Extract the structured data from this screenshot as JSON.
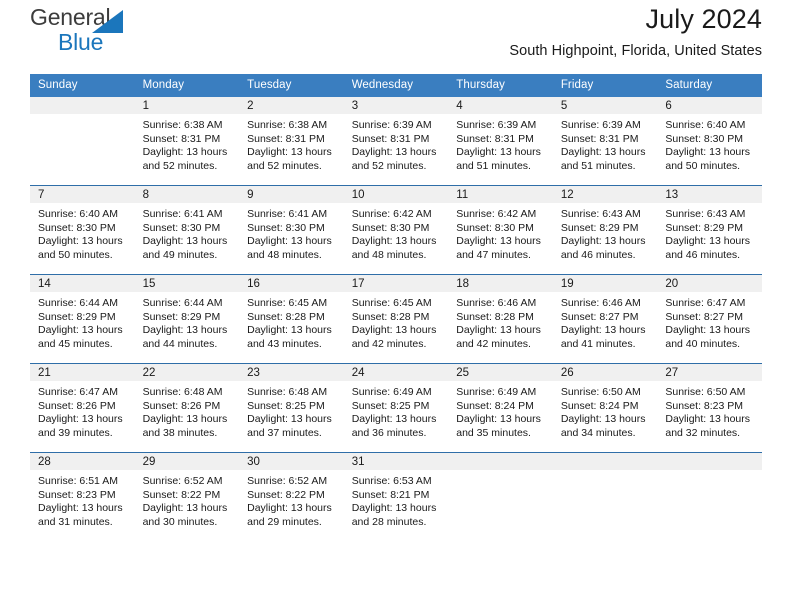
{
  "brand": {
    "word1": "General",
    "word2": "Blue",
    "triangle_color": "#1b76bc",
    "text_color": "#3c3c3c"
  },
  "header": {
    "title": "July 2024",
    "location": "South Highpoint, Florida, United States"
  },
  "theme": {
    "header_bg": "#3a7ec0",
    "row_divider": "#2f6ea8",
    "daynum_bg": "#f0f0f0",
    "text": "#1a1a1a"
  },
  "weekdays": [
    "Sunday",
    "Monday",
    "Tuesday",
    "Wednesday",
    "Thursday",
    "Friday",
    "Saturday"
  ],
  "weeks": [
    {
      "days": [
        {
          "num": "",
          "sunrise": "",
          "sunset": "",
          "daylight1": "",
          "daylight2": "",
          "empty": true
        },
        {
          "num": "1",
          "sunrise": "Sunrise: 6:38 AM",
          "sunset": "Sunset: 8:31 PM",
          "daylight1": "Daylight: 13 hours",
          "daylight2": "and 52 minutes."
        },
        {
          "num": "2",
          "sunrise": "Sunrise: 6:38 AM",
          "sunset": "Sunset: 8:31 PM",
          "daylight1": "Daylight: 13 hours",
          "daylight2": "and 52 minutes."
        },
        {
          "num": "3",
          "sunrise": "Sunrise: 6:39 AM",
          "sunset": "Sunset: 8:31 PM",
          "daylight1": "Daylight: 13 hours",
          "daylight2": "and 52 minutes."
        },
        {
          "num": "4",
          "sunrise": "Sunrise: 6:39 AM",
          "sunset": "Sunset: 8:31 PM",
          "daylight1": "Daylight: 13 hours",
          "daylight2": "and 51 minutes."
        },
        {
          "num": "5",
          "sunrise": "Sunrise: 6:39 AM",
          "sunset": "Sunset: 8:31 PM",
          "daylight1": "Daylight: 13 hours",
          "daylight2": "and 51 minutes."
        },
        {
          "num": "6",
          "sunrise": "Sunrise: 6:40 AM",
          "sunset": "Sunset: 8:30 PM",
          "daylight1": "Daylight: 13 hours",
          "daylight2": "and 50 minutes."
        }
      ]
    },
    {
      "days": [
        {
          "num": "7",
          "sunrise": "Sunrise: 6:40 AM",
          "sunset": "Sunset: 8:30 PM",
          "daylight1": "Daylight: 13 hours",
          "daylight2": "and 50 minutes."
        },
        {
          "num": "8",
          "sunrise": "Sunrise: 6:41 AM",
          "sunset": "Sunset: 8:30 PM",
          "daylight1": "Daylight: 13 hours",
          "daylight2": "and 49 minutes."
        },
        {
          "num": "9",
          "sunrise": "Sunrise: 6:41 AM",
          "sunset": "Sunset: 8:30 PM",
          "daylight1": "Daylight: 13 hours",
          "daylight2": "and 48 minutes."
        },
        {
          "num": "10",
          "sunrise": "Sunrise: 6:42 AM",
          "sunset": "Sunset: 8:30 PM",
          "daylight1": "Daylight: 13 hours",
          "daylight2": "and 48 minutes."
        },
        {
          "num": "11",
          "sunrise": "Sunrise: 6:42 AM",
          "sunset": "Sunset: 8:30 PM",
          "daylight1": "Daylight: 13 hours",
          "daylight2": "and 47 minutes."
        },
        {
          "num": "12",
          "sunrise": "Sunrise: 6:43 AM",
          "sunset": "Sunset: 8:29 PM",
          "daylight1": "Daylight: 13 hours",
          "daylight2": "and 46 minutes."
        },
        {
          "num": "13",
          "sunrise": "Sunrise: 6:43 AM",
          "sunset": "Sunset: 8:29 PM",
          "daylight1": "Daylight: 13 hours",
          "daylight2": "and 46 minutes."
        }
      ]
    },
    {
      "days": [
        {
          "num": "14",
          "sunrise": "Sunrise: 6:44 AM",
          "sunset": "Sunset: 8:29 PM",
          "daylight1": "Daylight: 13 hours",
          "daylight2": "and 45 minutes."
        },
        {
          "num": "15",
          "sunrise": "Sunrise: 6:44 AM",
          "sunset": "Sunset: 8:29 PM",
          "daylight1": "Daylight: 13 hours",
          "daylight2": "and 44 minutes."
        },
        {
          "num": "16",
          "sunrise": "Sunrise: 6:45 AM",
          "sunset": "Sunset: 8:28 PM",
          "daylight1": "Daylight: 13 hours",
          "daylight2": "and 43 minutes."
        },
        {
          "num": "17",
          "sunrise": "Sunrise: 6:45 AM",
          "sunset": "Sunset: 8:28 PM",
          "daylight1": "Daylight: 13 hours",
          "daylight2": "and 42 minutes."
        },
        {
          "num": "18",
          "sunrise": "Sunrise: 6:46 AM",
          "sunset": "Sunset: 8:28 PM",
          "daylight1": "Daylight: 13 hours",
          "daylight2": "and 42 minutes."
        },
        {
          "num": "19",
          "sunrise": "Sunrise: 6:46 AM",
          "sunset": "Sunset: 8:27 PM",
          "daylight1": "Daylight: 13 hours",
          "daylight2": "and 41 minutes."
        },
        {
          "num": "20",
          "sunrise": "Sunrise: 6:47 AM",
          "sunset": "Sunset: 8:27 PM",
          "daylight1": "Daylight: 13 hours",
          "daylight2": "and 40 minutes."
        }
      ]
    },
    {
      "days": [
        {
          "num": "21",
          "sunrise": "Sunrise: 6:47 AM",
          "sunset": "Sunset: 8:26 PM",
          "daylight1": "Daylight: 13 hours",
          "daylight2": "and 39 minutes."
        },
        {
          "num": "22",
          "sunrise": "Sunrise: 6:48 AM",
          "sunset": "Sunset: 8:26 PM",
          "daylight1": "Daylight: 13 hours",
          "daylight2": "and 38 minutes."
        },
        {
          "num": "23",
          "sunrise": "Sunrise: 6:48 AM",
          "sunset": "Sunset: 8:25 PM",
          "daylight1": "Daylight: 13 hours",
          "daylight2": "and 37 minutes."
        },
        {
          "num": "24",
          "sunrise": "Sunrise: 6:49 AM",
          "sunset": "Sunset: 8:25 PM",
          "daylight1": "Daylight: 13 hours",
          "daylight2": "and 36 minutes."
        },
        {
          "num": "25",
          "sunrise": "Sunrise: 6:49 AM",
          "sunset": "Sunset: 8:24 PM",
          "daylight1": "Daylight: 13 hours",
          "daylight2": "and 35 minutes."
        },
        {
          "num": "26",
          "sunrise": "Sunrise: 6:50 AM",
          "sunset": "Sunset: 8:24 PM",
          "daylight1": "Daylight: 13 hours",
          "daylight2": "and 34 minutes."
        },
        {
          "num": "27",
          "sunrise": "Sunrise: 6:50 AM",
          "sunset": "Sunset: 8:23 PM",
          "daylight1": "Daylight: 13 hours",
          "daylight2": "and 32 minutes."
        }
      ]
    },
    {
      "days": [
        {
          "num": "28",
          "sunrise": "Sunrise: 6:51 AM",
          "sunset": "Sunset: 8:23 PM",
          "daylight1": "Daylight: 13 hours",
          "daylight2": "and 31 minutes."
        },
        {
          "num": "29",
          "sunrise": "Sunrise: 6:52 AM",
          "sunset": "Sunset: 8:22 PM",
          "daylight1": "Daylight: 13 hours",
          "daylight2": "and 30 minutes."
        },
        {
          "num": "30",
          "sunrise": "Sunrise: 6:52 AM",
          "sunset": "Sunset: 8:22 PM",
          "daylight1": "Daylight: 13 hours",
          "daylight2": "and 29 minutes."
        },
        {
          "num": "31",
          "sunrise": "Sunrise: 6:53 AM",
          "sunset": "Sunset: 8:21 PM",
          "daylight1": "Daylight: 13 hours",
          "daylight2": "and 28 minutes."
        },
        {
          "num": "",
          "sunrise": "",
          "sunset": "",
          "daylight1": "",
          "daylight2": "",
          "empty": true
        },
        {
          "num": "",
          "sunrise": "",
          "sunset": "",
          "daylight1": "",
          "daylight2": "",
          "empty": true
        },
        {
          "num": "",
          "sunrise": "",
          "sunset": "",
          "daylight1": "",
          "daylight2": "",
          "empty": true
        }
      ]
    }
  ]
}
